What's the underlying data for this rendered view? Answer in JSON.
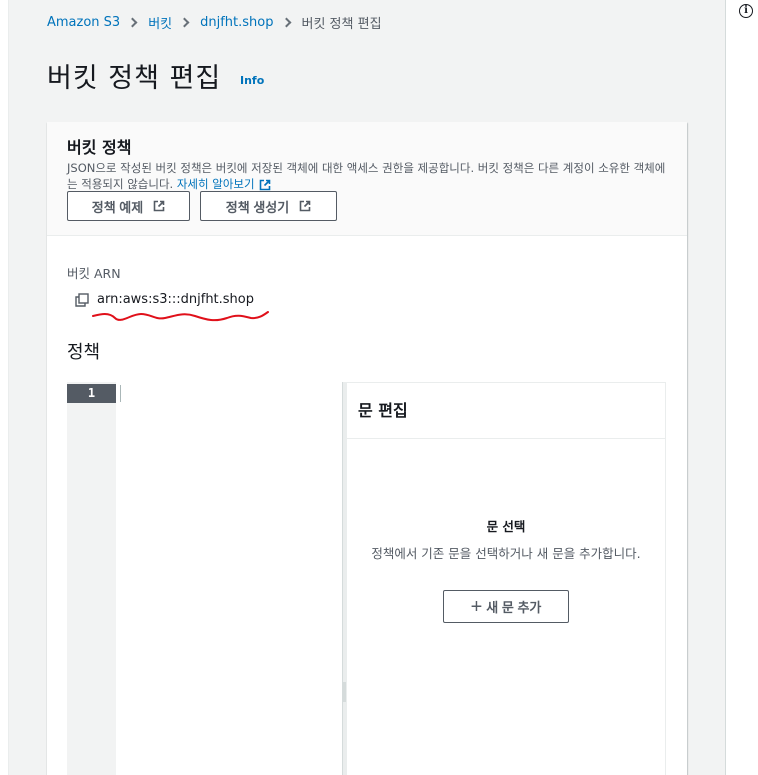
{
  "breadcrumb": {
    "items": [
      {
        "label": "Amazon S3"
      },
      {
        "label": "버킷"
      },
      {
        "label": "dnjfht.shop"
      }
    ],
    "current": "버킷 정책 편집"
  },
  "page": {
    "title": "버킷 정책 편집",
    "info_label": "Info"
  },
  "help_panel": {
    "icon": "info-circle-icon",
    "glyph": "i"
  },
  "card": {
    "title": "버킷 정책",
    "description": "JSON으로 작성된 버킷 정책은 버킷에 저장된 객체에 대한 액세스 권한을 제공합니다. 버킷 정책은 다른 계정이 소유한 객체에는 적용되지 않습니다.",
    "learn_more_label": "자세히 알아보기",
    "buttons": {
      "policy_examples": "정책 예제",
      "policy_generator": "정책 생성기"
    },
    "arn_label": "버킷 ARN",
    "arn_value": "arn:aws:s3:::dnjfht.shop",
    "policy_label": "정책"
  },
  "editor": {
    "line_number": "1",
    "content": ""
  },
  "statement_panel": {
    "title": "문 편집",
    "empty_title": "문 선택",
    "empty_description": "정책에서 기존 문을 선택하거나 새 문을 추가합니다.",
    "add_button_icon": "+",
    "add_button_label": "새 문 추가"
  },
  "colors": {
    "link": "#0073bb",
    "text": "#16191f",
    "secondary_text": "#545b64",
    "background": "#f2f3f3",
    "annotation": "#e0101a"
  }
}
